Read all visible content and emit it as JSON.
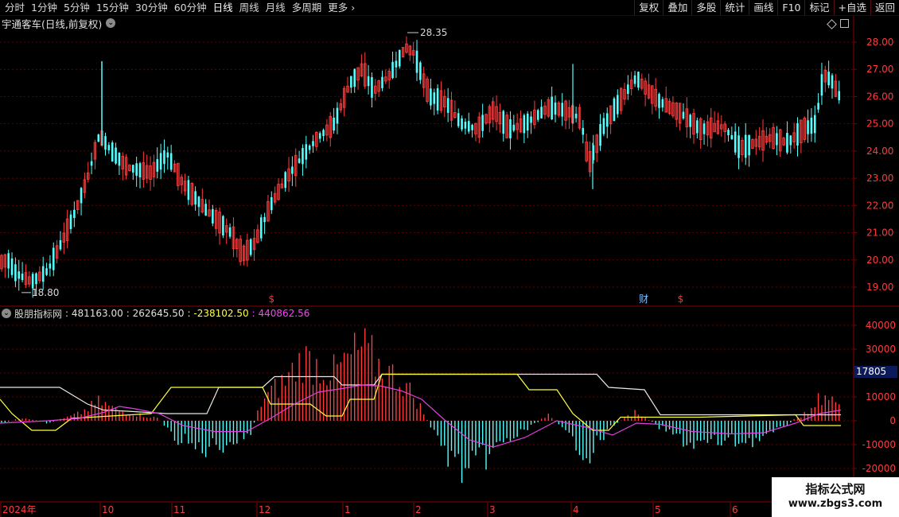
{
  "toolbar": {
    "periods": [
      "分时",
      "1分钟",
      "5分钟",
      "15分钟",
      "30分钟",
      "60分钟",
      "日线",
      "周线",
      "月线",
      "多周期",
      "更多"
    ],
    "active_period": "日线",
    "right_buttons": [
      "复权",
      "叠加",
      "多股",
      "统计",
      "画线",
      "F10",
      "标记",
      "+自选",
      "返回"
    ]
  },
  "main_chart": {
    "title": "宇通客车(日线,前复权)",
    "high_label": "28.35",
    "low_label": "18.80",
    "markers": [
      {
        "text": "$",
        "color": "#ff3030",
        "x_frac": 0.302
      },
      {
        "text": "财",
        "color": "#80c0ff",
        "x_frac": 0.716
      },
      {
        "text": "$",
        "color": "#ff3030",
        "x_frac": 0.757
      }
    ]
  },
  "price_axis": [
    "28.00",
    "27.00",
    "26.00",
    "25.00",
    "24.00",
    "23.00",
    "22.00",
    "21.00",
    "20.00",
    "19.00"
  ],
  "indicator": {
    "name": "股朋指标网",
    "values": [
      {
        "text": ": 481163.00",
        "color": "#e0e0e0"
      },
      {
        "text": ": 262645.50",
        "color": "#e0e0e0"
      },
      {
        "text": ": -238102.50",
        "color": "#ffff40"
      },
      {
        "text": ": 440862.56",
        "color": "#ff40ff"
      }
    ],
    "axis": [
      "40000",
      "30000",
      "20000",
      "10000",
      "0",
      "-10000",
      "-20000"
    ],
    "current_tag": "17805"
  },
  "date_axis": [
    "2024年",
    "10",
    "11",
    "12",
    "1",
    "2",
    "3",
    "4",
    "5",
    "6"
  ],
  "watermark": {
    "title": "指标公式网",
    "url": "www.zbgs3.com"
  },
  "colors": {
    "up": "#ff3c3c",
    "down": "#54ffff",
    "grid": "#8b0000",
    "axis_text": "#ff3c3c",
    "line_white": "#e8e8e8",
    "line_yellow": "#ffff40",
    "line_magenta": "#e040e0"
  },
  "icons": [
    "chevron-down-icon",
    "diamond-icon",
    "square-icon",
    "more-chevron-icon"
  ]
}
